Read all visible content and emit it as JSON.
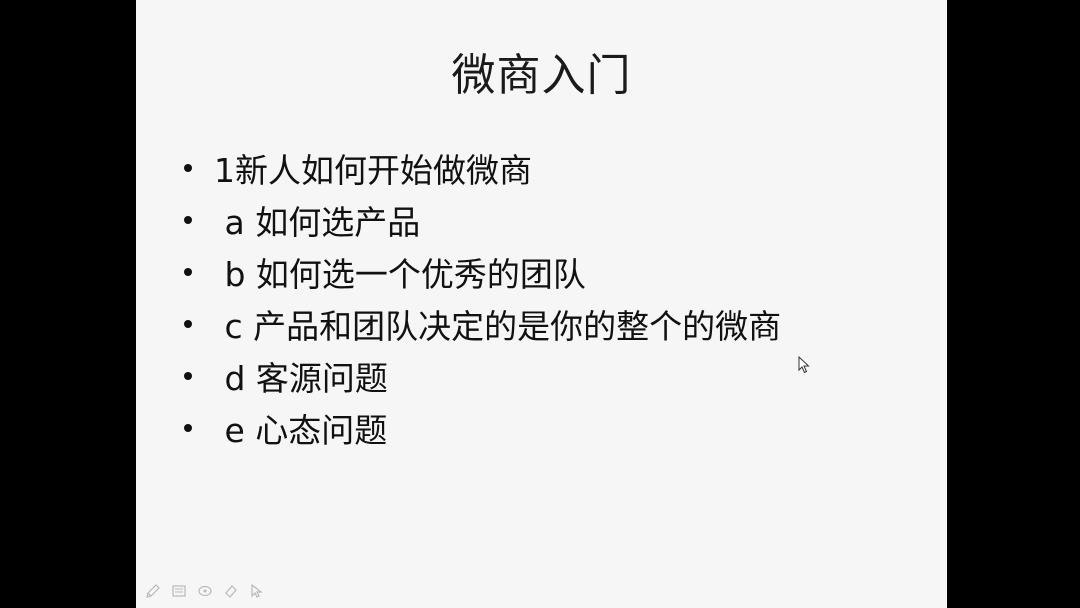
{
  "slide": {
    "title": "微商入门",
    "bullets": [
      "1新人如何开始做微商",
      " a 如何选产品",
      " b 如何选一个优秀的团队",
      " c 产品和团队决定的是你的整个的微商",
      " d 客源问题",
      " e 心态问题"
    ]
  },
  "toolbar": {
    "icons": [
      "pen-icon",
      "slides-icon",
      "highlighter-icon",
      "eraser-icon",
      "pointer-icon"
    ]
  },
  "colors": {
    "slide_background": "#f6f6f6",
    "letterbox": "#000000",
    "text": "#111111"
  }
}
